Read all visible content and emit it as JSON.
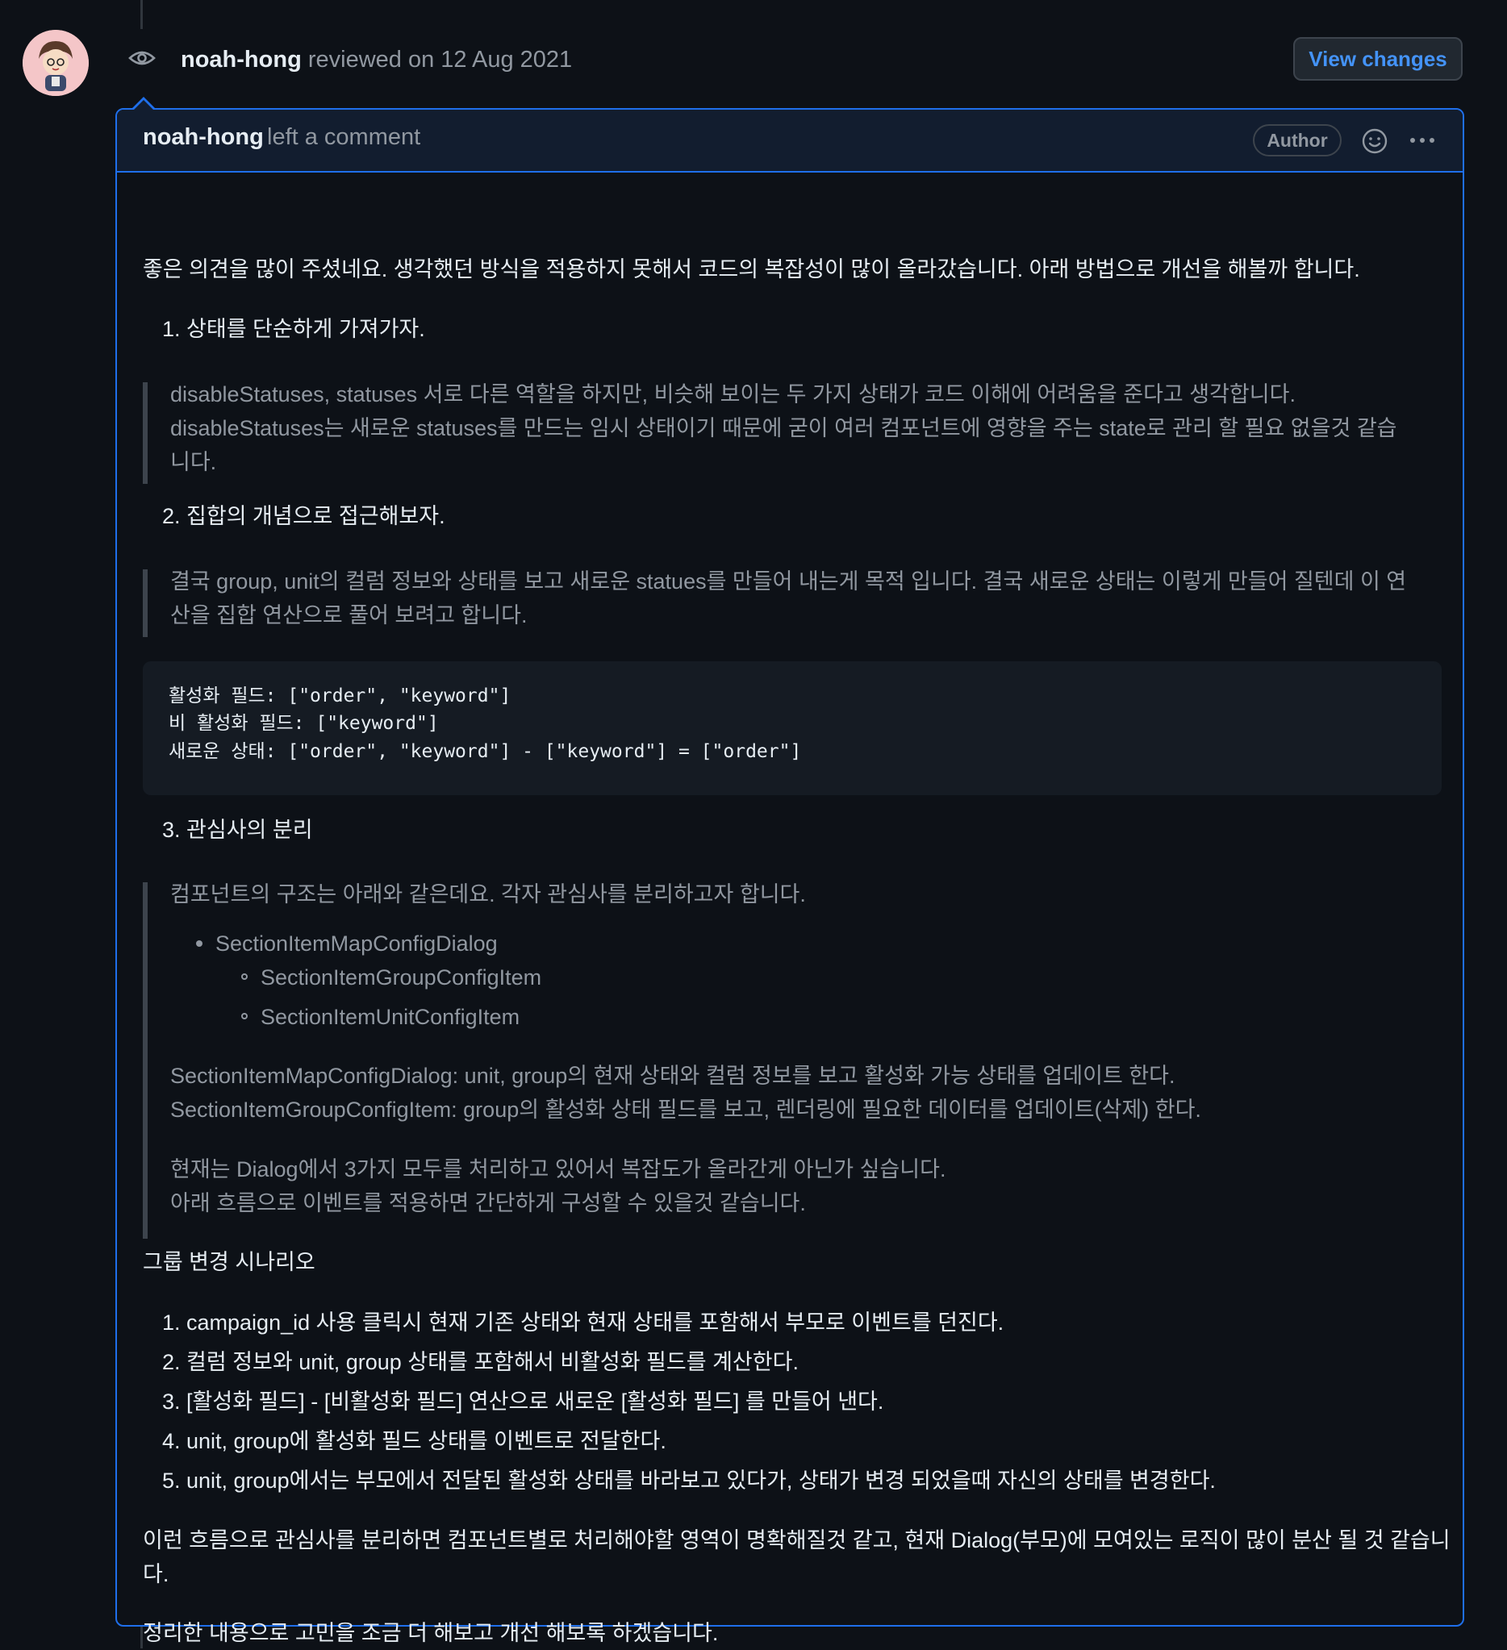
{
  "review": {
    "author": "noah-hong",
    "action": "reviewed",
    "date": "on 12 Aug 2021",
    "view_changes": "View changes"
  },
  "comment": {
    "author": "noah-hong",
    "action": "left a comment",
    "badge": "Author"
  },
  "content": {
    "intro": "좋은 의견을 많이 주셨네요. 생각했던 방식을 적용하지 못해서 코드의 복잡성이 많이 올라갔습니다. 아래 방법으로 개선을 해볼까 합니다.",
    "h1": "1. 상태를 단순하게 가져가자.",
    "q1_l1": "disableStatuses, statuses 서로 다른 역할을 하지만, 비슷해 보이는 두 가지 상태가 코드 이해에 어려움을 준다고 생각합니다.",
    "q1_l2": "disableStatuses는 새로운 statuses를 만드는 임시 상태이기 때문에 굳이 여러 컴포넌트에 영향을 주는 state로 관리 할 필요 없을것 같습",
    "q1_l3": "니다.",
    "h2": "2. 집합의 개념으로 접근해보자.",
    "q2_l1": "결국 group, unit의 컬럼 정보와 상태를 보고 새로운 statues를 만들어 내는게 목적 입니다. 결국 새로운 상태는 이렇게 만들어 질텐데 이 연",
    "q2_l2": "산을 집합 연산으로 풀어 보려고 합니다.",
    "code_l1": "활성화 필드: [\"order\", \"keyword\"]",
    "code_l2": "비 활성화 필드: [\"keyword\"]",
    "code_l3": "새로운 상태: [\"order\", \"keyword\"] - [\"keyword\"] = [\"order\"]",
    "h3": "3. 관심사의 분리",
    "q3_l1": "컴포넌트의 구조는 아래와 같은데요. 각자 관심사를 분리하고자 합니다.",
    "tree_root": "SectionItemMapConfigDialog",
    "tree_child1": "SectionItemGroupConfigItem",
    "tree_child2": "SectionItemUnitConfigItem",
    "q3_p1_l1": "SectionItemMapConfigDialog: unit, group의 현재 상태와 컬럼 정보를 보고 활성화 가능 상태를 업데이트 한다.",
    "q3_p1_l2": "SectionItemGroupConfigItem: group의 활성화 상태 필드를 보고, 렌더링에 필요한 데이터를 업데이트(삭제) 한다.",
    "q3_p2_l1": "현재는 Dialog에서 3가지 모두를 처리하고 있어서 복잡도가 올라간게 아닌가 싶습니다.",
    "q3_p2_l2": "아래 흐름으로 이벤트를 적용하면 간단하게 구성할 수 있을것 같습니다.",
    "scenario_title": "그룹 변경 시나리오",
    "steps": [
      "1. campaign_id 사용 클릭시 현재 기존 상태와 현재 상태를 포함해서 부모로 이벤트를 던진다.",
      "2. 컬럼 정보와 unit, group 상태를 포함해서 비활성화 필드를 계산한다.",
      "3. [활성화 필드] - [비활성화 필드] 연산으로 새로운 [활성화 필드] 를 만들어 낸다.",
      "4. unit, group에 활성화 필드 상태를 이벤트로 전달한다.",
      "5. unit, group에서는 부모에서 전달된 활성화 상태를 바라보고 있다가, 상태가 변경 되었을때 자신의 상태를 변경한다."
    ],
    "outro_l1": "이런 흐름으로 관심사를 분리하면 컴포넌트별로 처리해야할 영역이 명확해질것 같고, 현재 Dialog(부모)에 모여있는 로직이 많이 분산 될 것 같습니",
    "outro_l2": "다.",
    "closing": "정리한 내용으로 고민을 조금 더 해보고 개선 해보록 하겠습니다."
  }
}
